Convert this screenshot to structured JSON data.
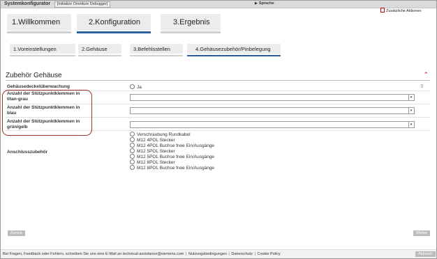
{
  "topbar": {
    "app_title": "Systemkonfigurator",
    "debug_button": "[initialize Omniture Debugger]",
    "language": "Sprache",
    "extra_actions": "Zusätzliche Aktionen"
  },
  "steps": [
    {
      "label": "1.Willkommen"
    },
    {
      "label": "2.Konfiguration"
    },
    {
      "label": "3.Ergebnis"
    }
  ],
  "subtabs": [
    {
      "label": "1.Voreinstellungen"
    },
    {
      "label": "2.Gehäuse"
    },
    {
      "label": "3.Befehlsstellen"
    },
    {
      "label": "4.Gehäusezubehör/Pinbelegung"
    }
  ],
  "section": {
    "title": "Zubehör Gehäuse",
    "help": "?"
  },
  "form": {
    "monitoring": {
      "label": "Gehäusedeckelüberwachung",
      "option": "Ja"
    },
    "titan": {
      "label_line1": "Anzahl der Stützpunktklemmen in",
      "label_line2": "titan-grau"
    },
    "blau": {
      "label_line1": "Anzahl der Stützpunktklemmen in",
      "label_line2": "blau"
    },
    "gruen": {
      "label_line1": "Anzahl der Stützpunktklemmen in",
      "label_line2": "grün/gelb"
    },
    "anschluss": {
      "label": "Anschlusszubehör",
      "options": [
        "Verschraubung Rundkabel",
        "M12 4POL Stecker",
        "M12 4POL Buchse freie Ein/Ausgänge",
        "M12 5POL Stecker",
        "M12 5POL Buchse freie Ein/Ausgänge",
        "M12 8POL Stecker",
        "M12 8POL Buchse freie Ein/Ausgänge"
      ]
    }
  },
  "buttons": {
    "back": "Zurück",
    "next": "Weiter",
    "cancel": "Abbruch"
  },
  "footer": {
    "text": "Bei Fragen, Feedback oder Fehlern, schreiben Sie uns eine E-Mail an",
    "email": "technical-assistance@siemens.com",
    "terms": "Nutzungsbedingungen",
    "privacy": "Datenschutz",
    "cookie": "Cookie Policy"
  },
  "colors": {
    "accent": "#2b5f9e",
    "highlight": "#a0342a",
    "collapse": "#cc0000"
  }
}
